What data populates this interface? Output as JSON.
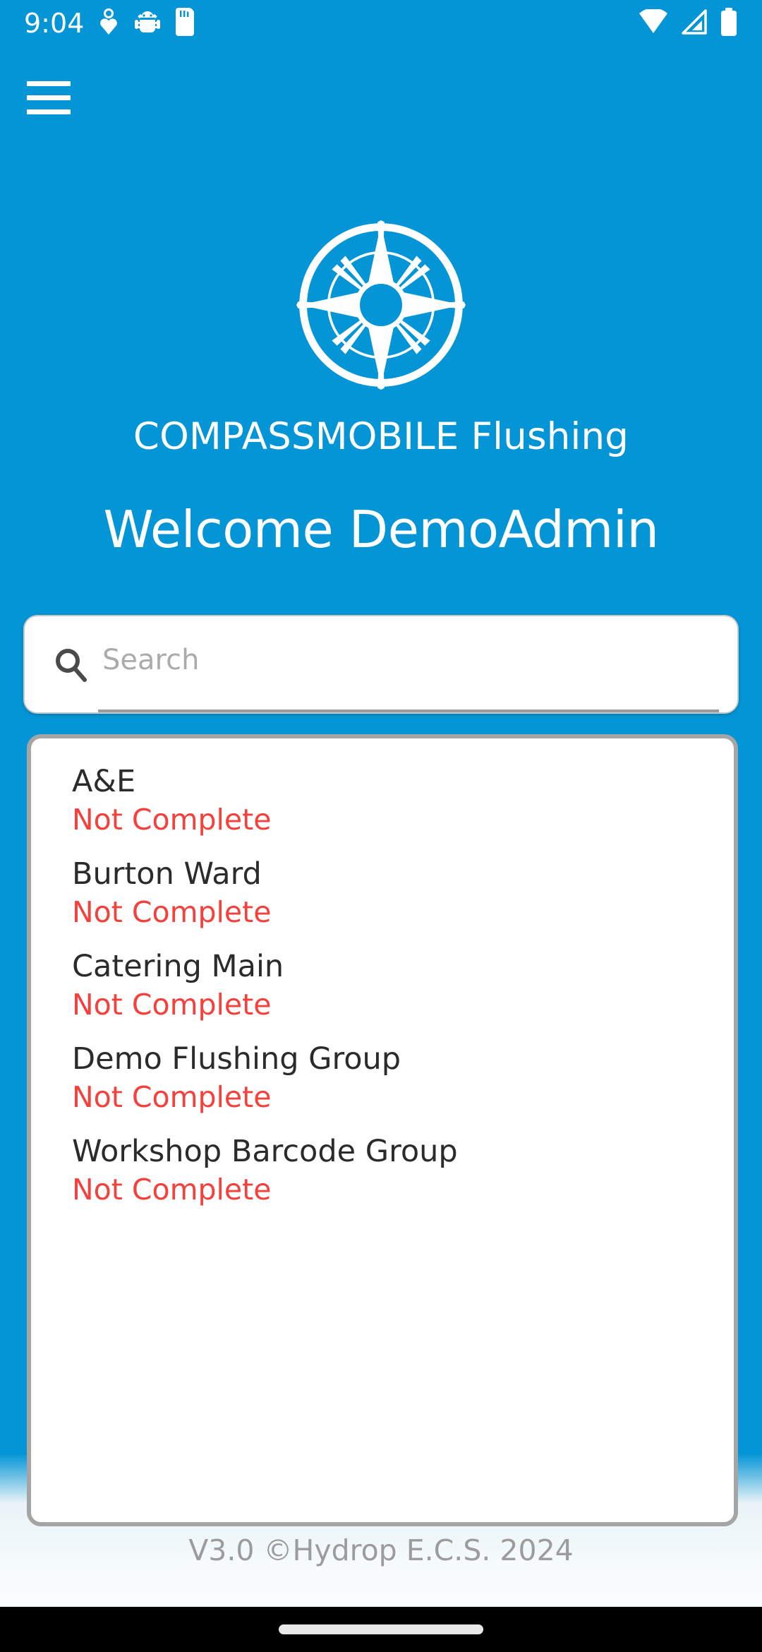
{
  "status_bar": {
    "time": "9:04",
    "left_icons": [
      "heart-activity-icon",
      "android-bug-icon",
      "sd-card-icon"
    ],
    "right_icons": [
      "wifi-icon",
      "cellular-signal-icon",
      "battery-icon"
    ]
  },
  "app_bar": {
    "menu_icon": "hamburger-menu-icon"
  },
  "branding": {
    "logo_icon": "compass-rose-logo",
    "app_title": "COMPASSMOBILE Flushing"
  },
  "header": {
    "welcome_text": "Welcome DemoAdmin"
  },
  "search": {
    "icon": "search-icon",
    "value": "",
    "placeholder": "Search"
  },
  "list": {
    "items": [
      {
        "name": "A&E",
        "status": "Not Complete"
      },
      {
        "name": "Burton Ward",
        "status": "Not Complete"
      },
      {
        "name": "Catering Main",
        "status": "Not Complete"
      },
      {
        "name": "Demo Flushing Group",
        "status": "Not Complete"
      },
      {
        "name": "Workshop Barcode Group",
        "status": "Not Complete"
      }
    ]
  },
  "footer": {
    "text": "V3.0 ©Hydrop E.C.S. 2024"
  },
  "nav_bar": {
    "home_indicator": "home-indicator-pill"
  },
  "colors": {
    "brand_blue": "#0495d6",
    "status_red": "#f6403c",
    "card_border": "#a5a5a5",
    "placeholder_gray": "#ababab",
    "footer_gray": "#9c9c9c"
  }
}
